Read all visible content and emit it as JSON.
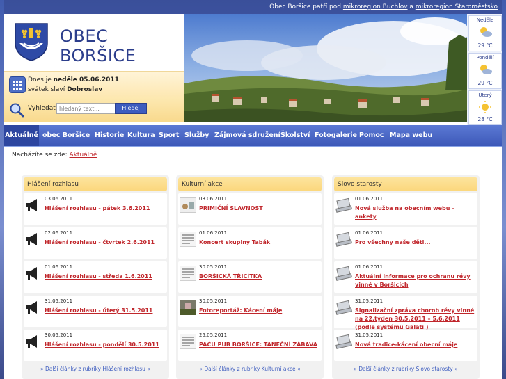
{
  "topbar": {
    "prefix": "Obec Boršice patří pod",
    "link1": "mikroregion Buchlov",
    "middle": "a",
    "link2": "mikroregion Staroměstsko"
  },
  "header": {
    "title": "OBEC BORŠICE",
    "date_prefix": "Dnes je",
    "date_value": "neděle 05.06.2011",
    "nameday_prefix": "svátek slaví",
    "nameday_value": "Dobroslav",
    "search_label": "Vyhledat:",
    "search_placeholder": "hledaný text...",
    "search_button": "Hledej"
  },
  "weather": [
    {
      "day": "Neděle",
      "temp": "29 °C"
    },
    {
      "day": "Pondělí",
      "temp": "29 °C"
    },
    {
      "day": "Úterý",
      "temp": "28 °C"
    }
  ],
  "nav": [
    {
      "label": "Aktuálně",
      "active": true
    },
    {
      "label": "obec Boršice"
    },
    {
      "label": "Historie"
    },
    {
      "label": "Kultura"
    },
    {
      "label": "Sport"
    },
    {
      "label": "Služby"
    },
    {
      "label": "Zájmová sdružení"
    },
    {
      "label": "Školství"
    },
    {
      "label": "Fotogalerie"
    },
    {
      "label": "Pomoc"
    },
    {
      "label": "Mapa webu"
    }
  ],
  "breadcrumb": {
    "label": "Nacházíte se zde:",
    "current": "Aktuálně"
  },
  "columns": [
    {
      "title": "Hlášení rozhlasu",
      "items": [
        {
          "date": "03.06.2011",
          "title": "Hlášení rozhlasu - pátek 3.6.2011"
        },
        {
          "date": "02.06.2011",
          "title": "Hlášení rozhlasu - čtvrtek 2.6.2011"
        },
        {
          "date": "01.06.2011",
          "title": "Hlášení rozhlasu - středa 1.6.2011"
        },
        {
          "date": "31.05.2011",
          "title": "Hlášení rozhlasu - úterý 31.5.2011"
        },
        {
          "date": "30.05.2011",
          "title": "Hlášení rozhlasu - pondělí 30.5.2011"
        }
      ],
      "more": "» Další články z rubriky Hlášení rozhlasu «"
    },
    {
      "title": "Kulturní akce",
      "items": [
        {
          "date": "03.06.2011",
          "title": "PRIMIČNÍ SLAVNOST"
        },
        {
          "date": "01.06.2011",
          "title": "Koncert skupiny Tabák"
        },
        {
          "date": "30.05.2011",
          "title": "BORŠICKÁ TŘICÍTKA"
        },
        {
          "date": "30.05.2011",
          "title": "Fotoreportáž: Kácení máje"
        },
        {
          "date": "25.05.2011",
          "title": "PAĆU PUB BORŠICE: TANEČNÍ ZÁBAVA"
        }
      ],
      "more": "» Další články z rubriky Kulturní akce «"
    },
    {
      "title": "Slovo starosty",
      "items": [
        {
          "date": "01.06.2011",
          "title": "Nová služba na obecním webu - ankety"
        },
        {
          "date": "01.06.2011",
          "title": "Pro všechny naše děti..."
        },
        {
          "date": "01.06.2011",
          "title": "Aktuální informace pro ochranu révy vinné v Boršicích"
        },
        {
          "date": "31.05.2011",
          "title": "Signalizační zpráva chorob révy vinné na 22.týden 30.5.2011 – 5.6.2011 (podle systému Galati )"
        },
        {
          "date": "31.05.2011",
          "title": "Nová tradice-kácení obecní máje"
        }
      ],
      "more": "» Další články z rubriky Slovo starosty «"
    }
  ],
  "icons": {
    "col0": "megaphone-icon",
    "col1": "event-thumbnail",
    "col2": "laptop-icon"
  },
  "colors": {
    "accent_blue": "#3d5cbf",
    "link_red": "#c0262b",
    "header_yellow": "#fde49d"
  }
}
